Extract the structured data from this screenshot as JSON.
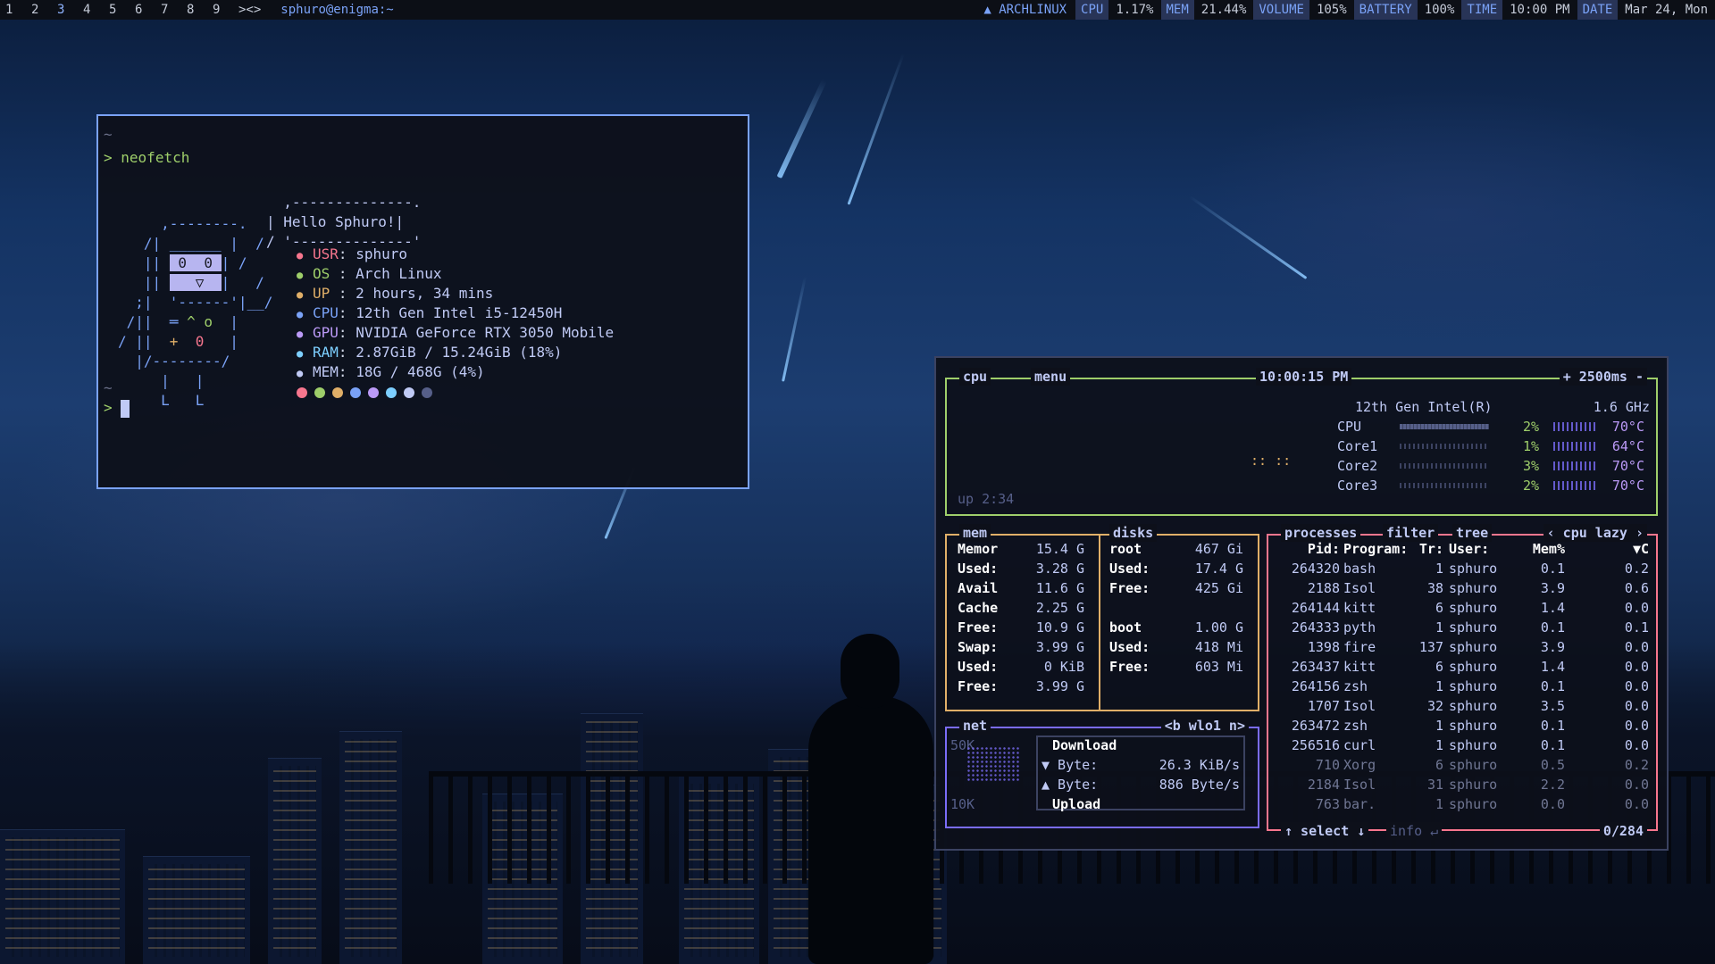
{
  "topbar": {
    "workspaces": [
      {
        "label": "1",
        "active": false
      },
      {
        "label": "2",
        "active": false
      },
      {
        "label": "3",
        "active": true
      },
      {
        "label": "4",
        "active": false
      },
      {
        "label": "5",
        "active": false
      },
      {
        "label": "6",
        "active": false
      },
      {
        "label": "7",
        "active": false
      },
      {
        "label": "8",
        "active": false
      },
      {
        "label": "9",
        "active": false
      }
    ],
    "layout_mode": "><>",
    "window_title": "sphuro@enigma:~",
    "distro": "ARCHLINUX",
    "cpu_label": "CPU",
    "cpu_value": "1.17%",
    "mem_label": "MEM",
    "mem_value": "21.44%",
    "volume_label": "VOLUME",
    "volume_value": "105%",
    "battery_label": "BATTERY",
    "battery_value": "100%",
    "time_label": "TIME",
    "time_value": "10:00 PM",
    "date_label": "DATE",
    "date_value": "Mar 24, Mon"
  },
  "terminal": {
    "tilde": "~",
    "prompt": ">",
    "command": "neofetch",
    "greeting": "| Hello Sphuro!|",
    "info": [
      {
        "key": "USR",
        "sep": ":",
        "value": "sphuro",
        "icon": "user-icon",
        "color": "#f7768e"
      },
      {
        "key": "OS",
        "sep": " :",
        "value": "Arch Linux",
        "icon": "arch-icon",
        "color": "#9ece6a"
      },
      {
        "key": "UP",
        "sep": " :",
        "value": "2 hours, 34 mins",
        "icon": "hourglass-icon",
        "color": "#e0af68"
      },
      {
        "key": "CPU",
        "sep": ":",
        "value": "12th Gen Intel i5-12450H",
        "icon": "cpu-icon",
        "color": "#7aa2f7"
      },
      {
        "key": "GPU",
        "sep": ":",
        "value": "NVIDIA GeForce RTX 3050 Mobile",
        "icon": "gpu-icon",
        "color": "#bb9af7"
      },
      {
        "key": "RAM",
        "sep": ":",
        "value": "2.87GiB / 15.24GiB (18%)",
        "icon": "ram-icon",
        "color": "#7dcfff"
      },
      {
        "key": "MEM",
        "sep": ":",
        "value": "18G / 468G (4%)",
        "icon": "disk-icon",
        "color": "#c0caf5"
      }
    ],
    "palette": [
      "#f7768e",
      "#9ece6a",
      "#e0af68",
      "#7aa2f7",
      "#bb9af7",
      "#7dcfff",
      "#c0caf5",
      "#565f89"
    ]
  },
  "btop": {
    "cpu": {
      "tab_cpu": "cpu",
      "tab_menu": "menu",
      "clock": "10:00:15 PM",
      "interval": "+ 2500ms -",
      "model": "12th Gen Intel(R)",
      "freq": "1.6 GHz",
      "uptime": "up 2:34",
      "rows": [
        {
          "name": "CPU",
          "pct": "2%",
          "temp": "70°C"
        },
        {
          "name": "Core1",
          "pct": "1%",
          "temp": "64°C"
        },
        {
          "name": "Core2",
          "pct": "3%",
          "temp": "70°C"
        },
        {
          "name": "Core3",
          "pct": "2%",
          "temp": "70°C"
        }
      ]
    },
    "mem": {
      "tab": "mem",
      "rows": [
        {
          "k": "Memor",
          "v": "15.4 G"
        },
        {
          "k": "Used:",
          "v": "3.28 G"
        },
        {
          "k": "Avail",
          "v": "11.6 G"
        },
        {
          "k": "Cache",
          "v": "2.25 G"
        },
        {
          "k": "Free:",
          "v": "10.9 G"
        },
        {
          "k": "Swap:",
          "v": "3.99 G"
        },
        {
          "k": "Used:",
          "v": "0 KiB"
        },
        {
          "k": "Free:",
          "v": "3.99 G"
        }
      ]
    },
    "disks": {
      "tab": "disks",
      "rows": [
        {
          "k": "root",
          "v": "467 Gi"
        },
        {
          "k": "Used:",
          "v": "17.4 G"
        },
        {
          "k": "Free:",
          "v": "425 Gi"
        },
        {
          "k": "",
          "v": ""
        },
        {
          "k": "boot",
          "v": "1.00 G"
        },
        {
          "k": "Used:",
          "v": "418 Mi"
        },
        {
          "k": "Free:",
          "v": "603 Mi"
        }
      ]
    },
    "net": {
      "tab": "net",
      "iface": "<b wlo1 n>",
      "scale_top": "50K",
      "scale_bottom": "10K",
      "download_label": "Download",
      "upload_label": "Upload",
      "down_key": "▼ Byte:",
      "down_val": "26.3 KiB/s",
      "up_key": "▲ Byte:",
      "up_val": "886 Byte/s"
    },
    "proc": {
      "tab": "processes",
      "filter": "filter",
      "tree": "tree",
      "sort": "‹ cpu lazy ›",
      "headers": {
        "pid": "Pid:",
        "prog": "Program:",
        "tr": "Tr:",
        "user": "User:",
        "mem": "Mem%",
        "cpu": "▼C"
      },
      "rows": [
        {
          "pid": "264320",
          "prog": "bash",
          "tr": "1",
          "user": "sphuro",
          "mem": "0.1",
          "cpu": "0.2"
        },
        {
          "pid": "2188",
          "prog": "Isol",
          "tr": "38",
          "user": "sphuro",
          "mem": "3.9",
          "cpu": "0.6"
        },
        {
          "pid": "264144",
          "prog": "kitt",
          "tr": "6",
          "user": "sphuro",
          "mem": "1.4",
          "cpu": "0.0"
        },
        {
          "pid": "264333",
          "prog": "pyth",
          "tr": "1",
          "user": "sphuro",
          "mem": "0.1",
          "cpu": "0.1"
        },
        {
          "pid": "1398",
          "prog": "fire",
          "tr": "137",
          "user": "sphuro",
          "mem": "3.9",
          "cpu": "0.0"
        },
        {
          "pid": "263437",
          "prog": "kitt",
          "tr": "6",
          "user": "sphuro",
          "mem": "1.4",
          "cpu": "0.0"
        },
        {
          "pid": "264156",
          "prog": "zsh",
          "tr": "1",
          "user": "sphuro",
          "mem": "0.1",
          "cpu": "0.0"
        },
        {
          "pid": "1707",
          "prog": "Isol",
          "tr": "32",
          "user": "sphuro",
          "mem": "3.5",
          "cpu": "0.0"
        },
        {
          "pid": "263472",
          "prog": "zsh",
          "tr": "1",
          "user": "sphuro",
          "mem": "0.1",
          "cpu": "0.0"
        },
        {
          "pid": "256516",
          "prog": "curl",
          "tr": "1",
          "user": "sphuro",
          "mem": "0.1",
          "cpu": "0.0"
        },
        {
          "pid": "710",
          "prog": "Xorg",
          "tr": "6",
          "user": "sphuro",
          "mem": "0.5",
          "cpu": "0.2"
        },
        {
          "pid": "2184",
          "prog": "Isol",
          "tr": "31",
          "user": "sphuro",
          "mem": "2.2",
          "cpu": "0.0"
        },
        {
          "pid": "763",
          "prog": "bar.",
          "tr": "1",
          "user": "sphuro",
          "mem": "0.0",
          "cpu": "0.0"
        }
      ],
      "select": "↑ select ↓",
      "info": "info ↵",
      "count": "0/284"
    }
  }
}
